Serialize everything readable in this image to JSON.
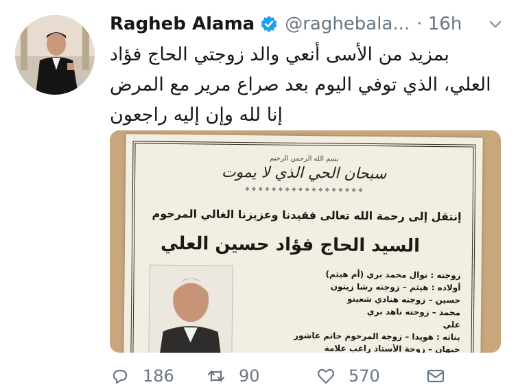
{
  "tweet": {
    "author_name": "Ragheb Alama",
    "author_handle": "@raghebala...",
    "time": "· 16h",
    "text_lines": [
      "بمزيد من الأسى أنعي والد زوجتي الحاج فؤاد",
      "العلي، الذي توفي اليوم بعد صراع مرير مع المرض",
      "إنا لله وإن إليه راجعون"
    ]
  },
  "media": {
    "basmala": "بسم الله الرحمن الرحيم",
    "headline": "سبحان الحي الذي لا يموت",
    "announce": "إنتقل إلى رحمة الله تعالى فقيدنا وعزيزنا الغالي المرحوم",
    "deceased": "السيد الحاج فؤاد حسين العلي",
    "family": [
      "زوجته : نوال محمد بري (أم هيثم)",
      "أولاده : هيثم – زوجته رشا زيتون",
      "حسين – زوجته هنادي شعيتو",
      "محمد – زوجته ناهد بري",
      "علي",
      "بناته : هويدا – زوجة المرحوم حاتم عاشور",
      "جيهان – زوجة الأستاذ راغب علامة"
    ]
  },
  "actions": {
    "replies": "186",
    "retweets": "90",
    "likes": "570"
  },
  "colors": {
    "text": "#14171a",
    "secondary": "#657786",
    "verified": "#1da1f2"
  }
}
